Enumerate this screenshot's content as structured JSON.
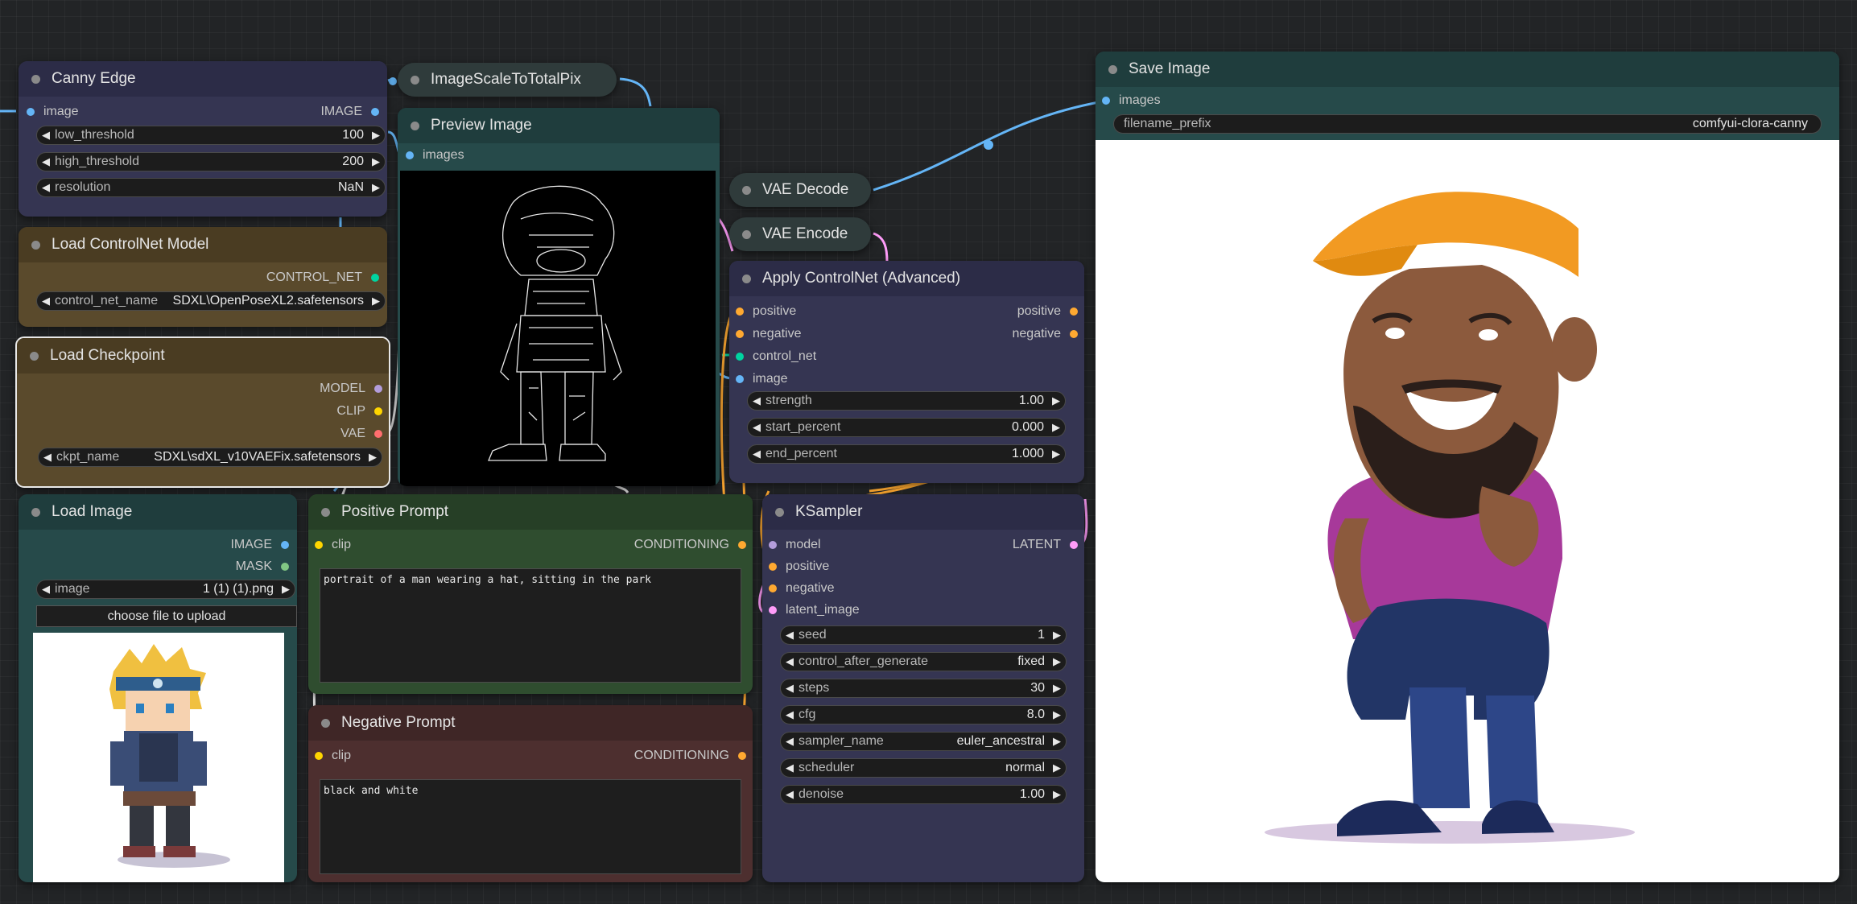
{
  "canny": {
    "title": "Canny Edge",
    "in_image": "image",
    "out_image": "IMAGE",
    "low_label": "low_threshold",
    "low_val": "100",
    "high_label": "high_threshold",
    "high_val": "200",
    "res_label": "resolution",
    "res_val": "NaN"
  },
  "scale": {
    "title": "ImageScaleToTotalPix"
  },
  "preview": {
    "title": "Preview Image",
    "in_images": "images"
  },
  "cnloader": {
    "title": "Load ControlNet Model",
    "out": "CONTROL_NET",
    "name_label": "control_net_name",
    "name_val": "SDXL\\OpenPoseXL2.safetensors"
  },
  "ckpt": {
    "title": "Load Checkpoint",
    "out_model": "MODEL",
    "out_clip": "CLIP",
    "out_vae": "VAE",
    "name_label": "ckpt_name",
    "name_val": "SDXL\\sdXL_v10VAEFix.safetensors"
  },
  "loadimg": {
    "title": "Load Image",
    "out_image": "IMAGE",
    "out_mask": "MASK",
    "image_label": "image",
    "image_val": "1 (1) (1).png",
    "upload": "choose file to upload"
  },
  "pos": {
    "title": "Positive Prompt",
    "in_clip": "clip",
    "out": "CONDITIONING",
    "text": "portrait of a man wearing a hat, sitting in the park"
  },
  "neg": {
    "title": "Negative Prompt",
    "in_clip": "clip",
    "out": "CONDITIONING",
    "text": "black and white"
  },
  "vaedec": {
    "title": "VAE Decode"
  },
  "vaeenc": {
    "title": "VAE Encode"
  },
  "apply": {
    "title": "Apply ControlNet (Advanced)",
    "in_pos": "positive",
    "in_neg": "negative",
    "in_cn": "control_net",
    "in_image": "image",
    "out_pos": "positive",
    "out_neg": "negative",
    "strength_label": "strength",
    "strength_val": "1.00",
    "start_label": "start_percent",
    "start_val": "0.000",
    "end_label": "end_percent",
    "end_val": "1.000"
  },
  "ksampler": {
    "title": "KSampler",
    "in_model": "model",
    "in_pos": "positive",
    "in_neg": "negative",
    "in_latent": "latent_image",
    "out": "LATENT",
    "seed_label": "seed",
    "seed_val": "1",
    "cag_label": "control_after_generate",
    "cag_val": "fixed",
    "steps_label": "steps",
    "steps_val": "30",
    "cfg_label": "cfg",
    "cfg_val": "8.0",
    "sampler_label": "sampler_name",
    "sampler_val": "euler_ancestral",
    "scheduler_label": "scheduler",
    "scheduler_val": "normal",
    "denoise_label": "denoise",
    "denoise_val": "1.00"
  },
  "save": {
    "title": "Save Image",
    "in_images": "images",
    "prefix_label": "filename_prefix",
    "prefix_val": "comfyui-clora-canny"
  },
  "colors": {
    "IMAGE": "#64b5f6",
    "MASK": "#81c784",
    "CONTROL_NET": "#00d4a0",
    "MODEL": "#b39ddb",
    "CLIP": "#ffd500",
    "VAE": "#ff6e6e",
    "CONDITIONING": "#ffa931",
    "LATENT": "#ff9cf9",
    "node_blue": "#353552",
    "node_brown": "#5a4a2c",
    "node_teal": "#264a4a",
    "node_green": "#2f4d2f",
    "node_red": "#4d2f2f"
  }
}
